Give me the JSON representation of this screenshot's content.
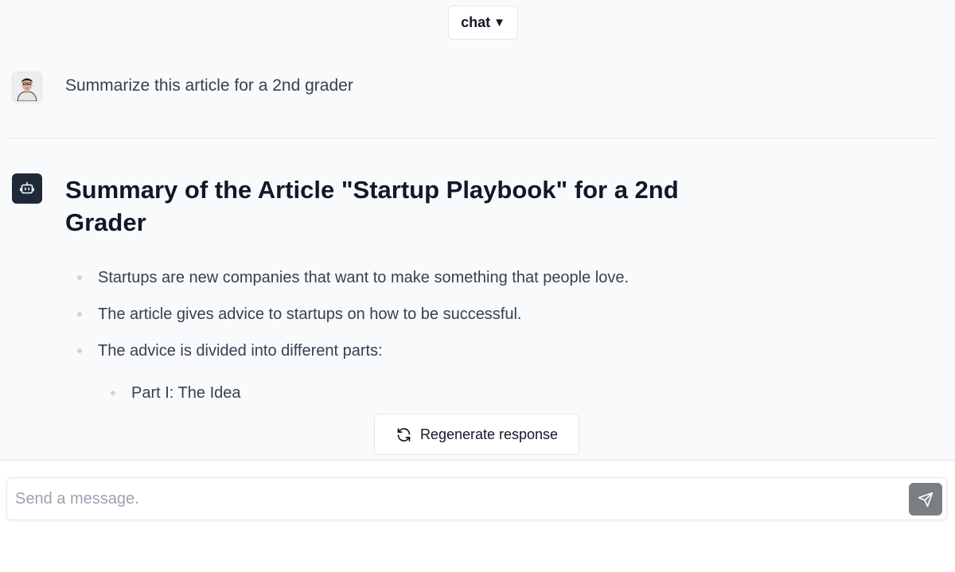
{
  "header": {
    "mode_label": "chat",
    "mode_caret": "▼"
  },
  "conversation": {
    "user_message": "Summarize this article for a 2nd grader",
    "assistant": {
      "title": "Summary of the Article \"Startup Playbook\" for a 2nd Grader",
      "bullets": [
        "Startups are new companies that want to make something that people love.",
        "The article gives advice to startups on how to be successful.",
        "The advice is divided into different parts:"
      ],
      "sub_bullets": [
        "Part I: The Idea"
      ]
    }
  },
  "actions": {
    "regenerate_label": "Regenerate response",
    "regenerate_icon": "refresh-icon"
  },
  "composer": {
    "placeholder": "Send a message.",
    "value": "",
    "send_icon": "send-icon"
  },
  "icons": {
    "user_avatar": "user-avatar-photo",
    "bot_avatar": "robot-icon"
  },
  "colors": {
    "chat_background": "#f9fafb",
    "bot_avatar_background": "#1f2937",
    "send_button": "#7b7f85"
  }
}
